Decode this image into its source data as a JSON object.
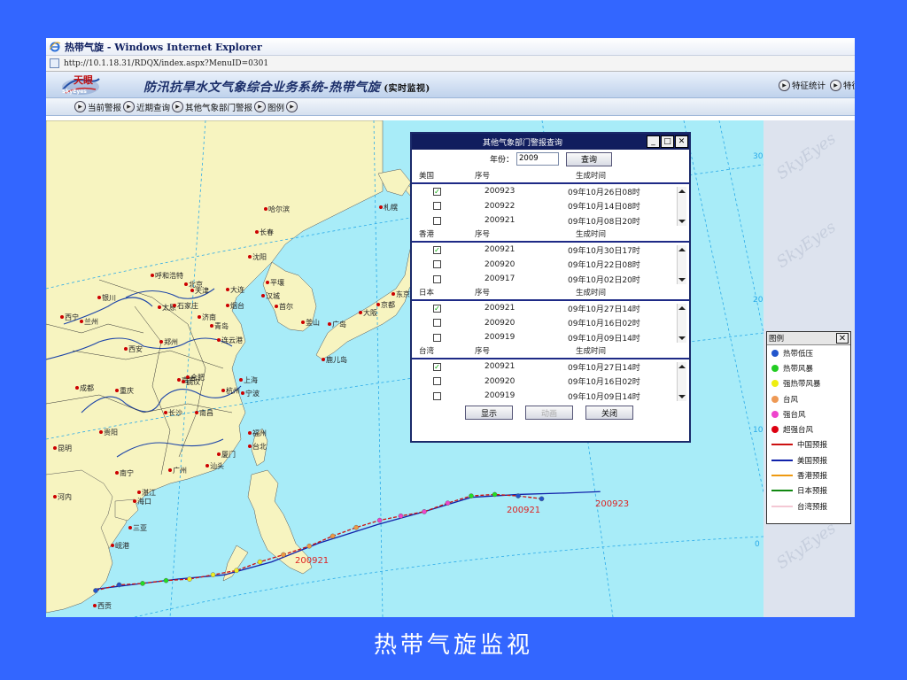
{
  "window": {
    "title": "热带气旋 - Windows Internet Explorer",
    "address": "http://10.1.18.31/RDQX/index.aspx?MenuID=0301"
  },
  "banner": {
    "logo_text": "天眼",
    "logo_sub": "SkyEyes",
    "system_name": "防汛抗旱水文气象综合业务系统-热带气旋",
    "system_sub": "(实时监视)",
    "right_buttons": [
      "特征统计",
      "特征"
    ]
  },
  "toolbar": {
    "items": [
      "当前警报",
      "近期查询",
      "其他气象部门警报",
      "图例"
    ]
  },
  "map": {
    "colors": {
      "ocean": "#a8ecf8",
      "land": "#f7f4c0",
      "river": "#1c44a8",
      "grid": "#29a9e8",
      "city": "#cc0000"
    },
    "cities": [
      "哈尔滨",
      "长春",
      "沈阳",
      "呼和浩特",
      "北京",
      "天津",
      "太原",
      "石家庄",
      "济南",
      "大连",
      "烟台",
      "平壤",
      "汉城",
      "首尔",
      "釜山",
      "银川",
      "西宁",
      "兰州",
      "西安",
      "郑州",
      "青岛",
      "连云港",
      "南京",
      "上海",
      "杭州",
      "宁波",
      "合肥",
      "武汉",
      "南昌",
      "长沙",
      "成都",
      "重庆",
      "贵阳",
      "昆明",
      "福州",
      "台北",
      "厦门",
      "汕头",
      "广州",
      "南宁",
      "海口",
      "湛江",
      "三亚",
      "河内",
      "岘港",
      "西贡",
      "札幌",
      "东京",
      "大阪",
      "广岛",
      "鹿儿岛",
      "京都"
    ],
    "lat_labels": [
      "30",
      "20",
      "10",
      "0"
    ],
    "track_labels": [
      "200921",
      "200921",
      "200923"
    ],
    "watermark": "SkyEyes"
  },
  "track_data": {
    "200921_cn": [
      [
        113.5,
        11.5
      ],
      [
        114.5,
        11.9
      ],
      [
        115.5,
        12.0
      ],
      [
        116.5,
        12.2
      ],
      [
        117.5,
        12.3
      ],
      [
        118.5,
        12.6
      ],
      [
        119.5,
        12.9
      ],
      [
        120.5,
        13.5
      ],
      [
        121.5,
        14.0
      ],
      [
        122.6,
        14.6
      ],
      [
        123.6,
        15.3
      ],
      [
        124.6,
        15.9
      ],
      [
        125.6,
        16.4
      ],
      [
        126.5,
        16.7
      ],
      [
        127.5,
        17.0
      ],
      [
        128.5,
        17.6
      ],
      [
        129.5,
        18.1
      ],
      [
        130.5,
        18.2
      ],
      [
        131.5,
        18.1
      ],
      [
        132.5,
        17.9
      ]
    ],
    "200923_us": [
      [
        113.5,
        11.6
      ],
      [
        115.0,
        11.9
      ],
      [
        117.0,
        12.3
      ],
      [
        119.0,
        12.6
      ],
      [
        121.0,
        13.5
      ],
      [
        123.0,
        14.8
      ],
      [
        125.5,
        16.1
      ],
      [
        127.5,
        17.0
      ],
      [
        129.5,
        18.0
      ],
      [
        131.5,
        18.2
      ],
      [
        133.5,
        18.3
      ],
      [
        135.0,
        18.4
      ]
    ],
    "point_colors": [
      "#2255cc",
      "#22dd22",
      "#eeee22",
      "#ee9944",
      "#ee44cc",
      "#dd0000"
    ]
  },
  "dialog": {
    "title": "其他气象部门警报查询",
    "year_label": "年份：",
    "year_value": "2009",
    "query_button": "查询",
    "col_no": "序号",
    "col_time": "生成时间",
    "sections": [
      {
        "name": "美国",
        "rows": [
          {
            "checked": true,
            "no": "200923",
            "time": "09年10月26日08时"
          },
          {
            "checked": false,
            "no": "200922",
            "time": "09年10月14日08时"
          },
          {
            "checked": false,
            "no": "200921",
            "time": "09年10月08日20时"
          }
        ]
      },
      {
        "name": "香港",
        "rows": [
          {
            "checked": true,
            "no": "200921",
            "time": "09年10月30日17时"
          },
          {
            "checked": false,
            "no": "200920",
            "time": "09年10月22日08时"
          },
          {
            "checked": false,
            "no": "200917",
            "time": "09年10月02日20时"
          }
        ]
      },
      {
        "name": "日本",
        "rows": [
          {
            "checked": true,
            "no": "200921",
            "time": "09年10月27日14时"
          },
          {
            "checked": false,
            "no": "200920",
            "time": "09年10月16日02时"
          },
          {
            "checked": false,
            "no": "200919",
            "time": "09年10月09日14时"
          }
        ]
      },
      {
        "name": "台湾",
        "rows": [
          {
            "checked": true,
            "no": "200921",
            "time": "09年10月27日14时"
          },
          {
            "checked": false,
            "no": "200920",
            "time": "09年10月16日02时"
          },
          {
            "checked": false,
            "no": "200919",
            "time": "09年10月09日14时"
          }
        ]
      }
    ],
    "buttons": {
      "show": "显示",
      "animate": "动画",
      "close": "关闭"
    }
  },
  "legend": {
    "title": "图例",
    "points": [
      {
        "label": "热带低压",
        "color": "#2255cc"
      },
      {
        "label": "热带风暴",
        "color": "#22cc22"
      },
      {
        "label": "强热带风暴",
        "color": "#eeee11"
      },
      {
        "label": "台风",
        "color": "#ee9955"
      },
      {
        "label": "强台风",
        "color": "#ee44cc"
      },
      {
        "label": "超强台风",
        "color": "#dd0011"
      }
    ],
    "lines": [
      {
        "label": "中国预报",
        "color": "#cc1111"
      },
      {
        "label": "美国预报",
        "color": "#1122aa"
      },
      {
        "label": "香港预报",
        "color": "#ee9911"
      },
      {
        "label": "日本预报",
        "color": "#118811"
      },
      {
        "label": "台湾预报",
        "color": "#f4c8d4"
      }
    ]
  },
  "caption": "热带气旋监视"
}
